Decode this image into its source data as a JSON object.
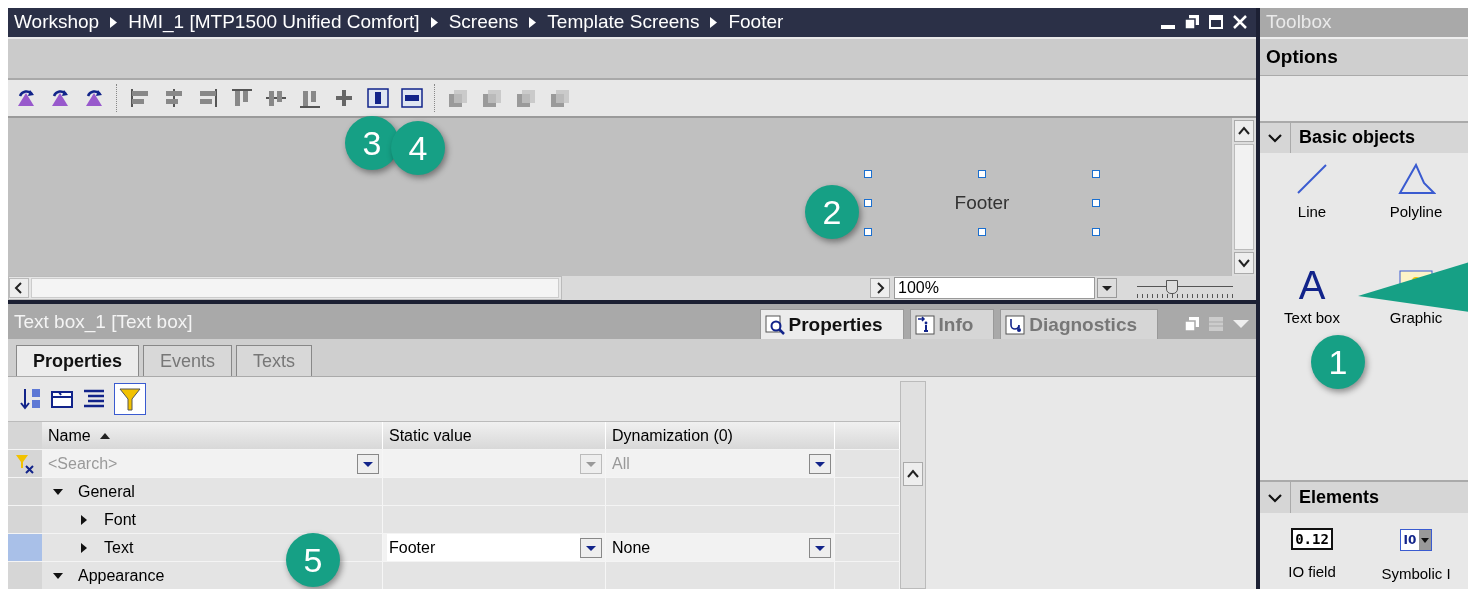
{
  "editor": {
    "breadcrumb": [
      "Workshop",
      "HMI_1 [MTP1500 Unified Comfort]",
      "Screens",
      "Template Screens",
      "Footer"
    ],
    "canvas": {
      "object": {
        "text": "Footer",
        "selected": true
      }
    },
    "zoom": {
      "value": "100%"
    },
    "zoom_slider": {
      "level": 0.35
    }
  },
  "inspector": {
    "title": "Text box_1 [Text box]",
    "tabs": [
      {
        "label": "Properties",
        "selected": true
      },
      {
        "label": "Info",
        "selected": false
      },
      {
        "label": "Diagnostics",
        "selected": false
      }
    ],
    "subtabs": [
      {
        "label": "Properties",
        "selected": true
      },
      {
        "label": "Events",
        "selected": false
      },
      {
        "label": "Texts",
        "selected": false
      }
    ],
    "filter_active": true,
    "table": {
      "columns": [
        "Name",
        "Static value",
        "Dynamization (0)"
      ],
      "filter": {
        "placeholder": "<Search>",
        "dynamization": "All"
      },
      "rows": [
        {
          "name": "General",
          "expanded": true,
          "selected": false,
          "children": [
            {
              "name": "Font",
              "expanded": false,
              "selected": false
            },
            {
              "name": "Text",
              "expanded": false,
              "selected": true,
              "static_value": "Footer",
              "dynamization": "None"
            }
          ]
        },
        {
          "name": "Appearance",
          "expanded": true,
          "selected": false
        }
      ]
    }
  },
  "toolbox": {
    "title": "Toolbox",
    "options": "Options",
    "sections": [
      {
        "title": "Basic objects",
        "expanded": true,
        "items": [
          {
            "kind": "line",
            "label": "Line"
          },
          {
            "kind": "polyline",
            "label": "Polyline"
          },
          {
            "kind": "text",
            "label": "Text box",
            "glyph": "A"
          },
          {
            "kind": "graphic",
            "label": "Graphic"
          }
        ]
      },
      {
        "title": "Elements",
        "expanded": true,
        "items": [
          {
            "kind": "iofield",
            "label": "IO field",
            "glyph": "0.12"
          },
          {
            "kind": "symbolic",
            "label": "Symbolic I",
            "glyph": "I0"
          }
        ]
      }
    ]
  },
  "callouts": [
    {
      "label": "1"
    },
    {
      "label": "2"
    },
    {
      "label": "3"
    },
    {
      "label": "4"
    },
    {
      "label": "5"
    }
  ]
}
